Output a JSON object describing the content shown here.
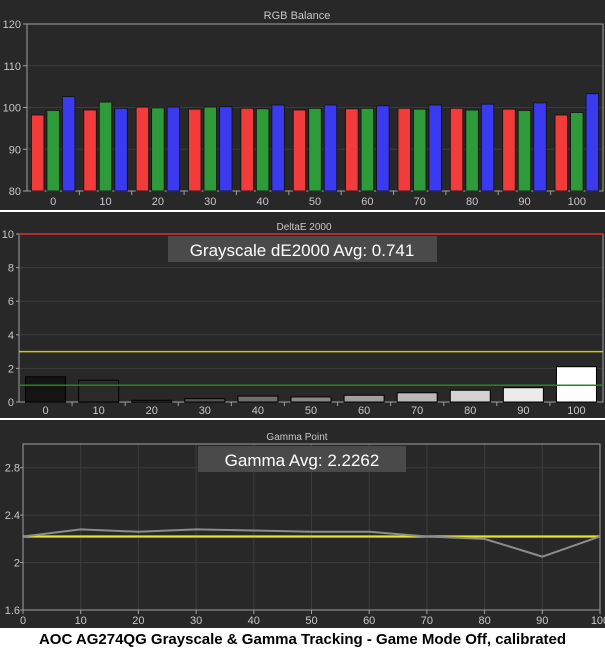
{
  "caption": "AOC AG274QG Grayscale & Gamma Tracking - Game Mode Off, calibrated",
  "colors": {
    "panel_bg": "#282828",
    "plot_border": "#a0a0a0",
    "text": "#c8c8c8",
    "red_bar": "#f23b3b",
    "green_bar": "#2f9a3a",
    "blue_bar": "#3a3af0",
    "threshold_high": "#d2c40f",
    "threshold_low": "#1e8a1e",
    "target_line": "#e6e41e",
    "measured_line": "#8c8c8c",
    "top_reference": "#e03030"
  },
  "chart_data": [
    {
      "type": "bar",
      "title": "RGB Balance",
      "categories": [
        "0",
        "10",
        "20",
        "30",
        "40",
        "50",
        "60",
        "70",
        "80",
        "90",
        "100"
      ],
      "ylim": [
        80,
        120
      ],
      "yticks": [
        "120",
        "110",
        "100",
        "90",
        "80"
      ],
      "grid": true,
      "series": [
        {
          "color": "red",
          "values": [
            98.2,
            99.4,
            100.1,
            99.6,
            99.8,
            99.4,
            99.7,
            99.8,
            99.8,
            99.6,
            98.2
          ]
        },
        {
          "color": "green",
          "values": [
            99.3,
            101.3,
            99.9,
            100.1,
            99.7,
            99.8,
            99.8,
            99.6,
            99.4,
            99.3,
            98.8
          ]
        },
        {
          "color": "blue",
          "values": [
            102.6,
            99.8,
            100.1,
            100.2,
            100.6,
            100.6,
            100.4,
            100.6,
            100.8,
            101.1,
            103.3
          ]
        }
      ]
    },
    {
      "type": "bar",
      "title": "DeltaE 2000",
      "annotation": "Grayscale dE2000 Avg: 0.741",
      "categories": [
        "0",
        "10",
        "20",
        "30",
        "40",
        "50",
        "60",
        "70",
        "80",
        "90",
        "100"
      ],
      "ylim": [
        0,
        10
      ],
      "yticks": [
        "10",
        "8",
        "6",
        "4",
        "2",
        "0"
      ],
      "grid": true,
      "values": [
        1.5,
        1.3,
        0.1,
        0.2,
        0.35,
        0.3,
        0.4,
        0.55,
        0.7,
        0.85,
        2.1
      ],
      "bar_colors": [
        "#141414",
        "#2a2a2a",
        "#3c3c3c",
        "#555555",
        "#6e6e6e",
        "#888888",
        "#a0a0a0",
        "#b9b9b9",
        "#d2d2d2",
        "#ebebeb",
        "#ffffff"
      ],
      "reference_lines": [
        {
          "y": 10,
          "color": "red"
        },
        {
          "y": 3,
          "color": "yellow"
        },
        {
          "y": 1,
          "color": "green"
        }
      ]
    },
    {
      "type": "line",
      "title": "Gamma Point",
      "annotation": "Gamma Avg: 2.2262",
      "x": [
        0,
        10,
        20,
        30,
        40,
        50,
        60,
        70,
        80,
        90,
        100
      ],
      "xticks": [
        "0",
        "10",
        "20",
        "30",
        "40",
        "50",
        "60",
        "70",
        "80",
        "90",
        "100"
      ],
      "ylim": [
        1.6,
        3.0
      ],
      "yticks": [
        "2.8",
        "2.4",
        "2",
        "1.6"
      ],
      "grid": true,
      "series": [
        {
          "color": "gray",
          "values": [
            2.22,
            2.28,
            2.26,
            2.28,
            2.27,
            2.26,
            2.26,
            2.22,
            2.2,
            2.05,
            2.22
          ]
        },
        {
          "color": "yellow",
          "values": [
            2.22,
            2.22,
            2.22,
            2.22,
            2.22,
            2.22,
            2.22,
            2.22,
            2.22,
            2.22,
            2.22
          ]
        }
      ]
    }
  ]
}
